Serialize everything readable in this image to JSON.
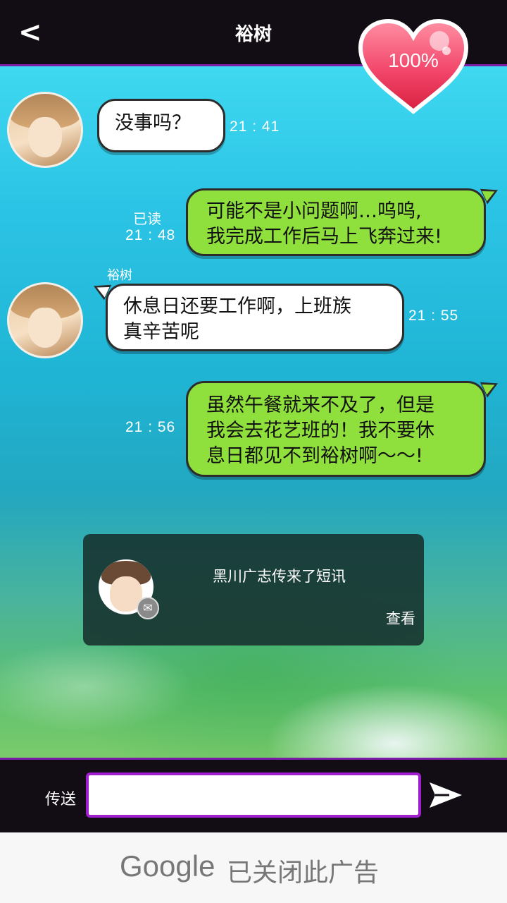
{
  "header": {
    "back_icon": "<",
    "title": "裕树",
    "affection_percent": "100%"
  },
  "messages": [
    {
      "side": "left",
      "lines": [
        "没事吗？"
      ],
      "time": "21 : 41"
    },
    {
      "side": "right",
      "lines": [
        "可能不是小问题啊…呜呜,",
        "我完成工作后马上飞奔过来!"
      ],
      "read_label": "已读",
      "time": "21 : 48"
    },
    {
      "side": "left",
      "sender": "裕树",
      "lines": [
        "休息日还要工作啊，上班族",
        "真辛苦呢"
      ],
      "time": "21 : 55"
    },
    {
      "side": "right",
      "lines": [
        "虽然午餐就来不及了，但是",
        "我会去花艺班的！我不要休",
        "息日都见不到裕树啊～～!"
      ],
      "time": "21 : 56"
    }
  ],
  "notification": {
    "text": "黑川广志传来了短讯",
    "view_label": "查看"
  },
  "input_bar": {
    "send_label": "传送",
    "input_value": ""
  },
  "ad": {
    "brand": "Google",
    "status": "已关闭此广告"
  },
  "colors": {
    "accent_purple": "#a020d0",
    "bubble_green": "#8fe03c",
    "heart_pink": "#f0506e"
  }
}
